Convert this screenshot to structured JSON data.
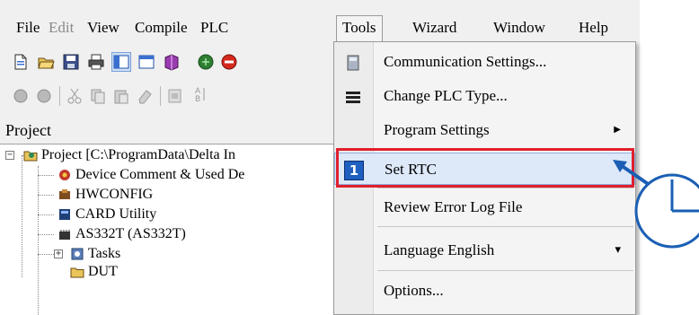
{
  "menubar": {
    "items": [
      {
        "label": "File",
        "state": "normal"
      },
      {
        "label": "Edit",
        "state": "disabled"
      },
      {
        "label": "View",
        "state": "normal"
      },
      {
        "label": "Compile",
        "state": "normal"
      },
      {
        "label": "PLC",
        "state": "normal"
      },
      {
        "label": "Tools",
        "state": "open"
      },
      {
        "label": "Wizard",
        "state": "normal"
      },
      {
        "label": "Window",
        "state": "normal"
      },
      {
        "label": "Help",
        "state": "normal"
      }
    ]
  },
  "toolbar1": {
    "buttons": [
      "new-file-icon",
      "open-folder-icon",
      "save-icon",
      "print-icon",
      "panel-toggle-icon",
      "window-icon",
      "book-icon",
      "go-online-icon",
      "stop-icon",
      "trash-icon"
    ]
  },
  "toolbar2": {
    "buttons": [
      "disabled-circle-icon",
      "disabled-circle-icon",
      "cut-icon",
      "copy-icon",
      "paste-icon",
      "eraser-icon",
      "find-icon",
      "sort-ab-icon"
    ],
    "sort_glyph": "A\nB"
  },
  "project_panel": {
    "title": "Project",
    "tree": [
      {
        "label": "Project [C:\\ProgramData\\Delta In",
        "icon": "project-folder-icon"
      },
      {
        "label": "Device Comment & Used De",
        "icon": "device-comment-icon"
      },
      {
        "label": "HWCONFIG",
        "icon": "hwconfig-icon"
      },
      {
        "label": "CARD Utility",
        "icon": "card-utility-icon"
      },
      {
        "label": "AS332T  (AS332T)",
        "icon": "plc-device-icon"
      },
      {
        "label": "Tasks",
        "icon": "tasks-icon"
      },
      {
        "label": "DUT",
        "icon": "dut-folder-icon"
      }
    ],
    "expanders": {
      "root": "−",
      "tasks": "+"
    }
  },
  "tools_menu": {
    "items": [
      {
        "label": "Communication Settings...",
        "icon": "communication-icon"
      },
      {
        "label": "Change PLC Type...",
        "icon": "change-plc-icon"
      },
      {
        "label": "Program Settings",
        "submenu_arrow": "▶"
      },
      {
        "label": "Set RTC",
        "icon": "rtc-icon",
        "icon_glyph": "1",
        "highlighted": true
      },
      {
        "label": "Review Error Log File"
      },
      {
        "label": "Language  English",
        "submenu_arrow": "▾"
      },
      {
        "label": "Options..."
      }
    ]
  },
  "colors": {
    "highlight_border": "#e0202e",
    "arrow_blue": "#1a5fb4",
    "menu_bg": "#f4f4f4",
    "app_bg": "#f0f0f0"
  }
}
